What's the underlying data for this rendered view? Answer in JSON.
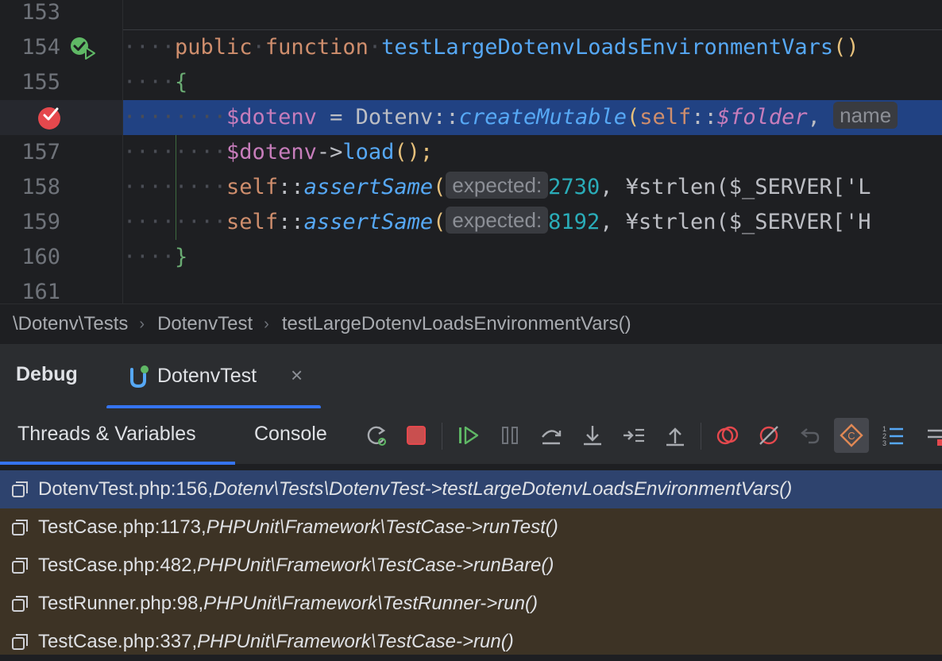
{
  "editor": {
    "line_numbers": [
      "153",
      "154",
      "155",
      "157",
      "158",
      "159",
      "160",
      "161"
    ],
    "code": {
      "l154_kw1": "public",
      "l154_kw2": "function",
      "l154_fn": "testLargeDotenvLoadsEnvironmentVars",
      "l154_paren": "()",
      "l155_brace": "{",
      "l156_var": "$dotenv",
      "l156_op": " = ",
      "l156_class": "Dotenv",
      "l156_sep": "::",
      "l156_method": "createMutable",
      "l156_open": "(",
      "l156_self": "self",
      "l156_sep2": "::",
      "l156_prop": "$folder",
      "l156_comma": ", ",
      "l156_hint": "name",
      "l157_var": "$dotenv",
      "l157_arrow": "->",
      "l157_method": "load",
      "l157_tail": "();",
      "l158_self": "self",
      "l158_sep": "::",
      "l158_method": "assertSame",
      "l158_open": "(",
      "l158_hint": "expected:",
      "l158_num": "2730",
      "l158_rest": ", ¥strlen($_SERVER['L",
      "l159_self": "self",
      "l159_sep": "::",
      "l159_method": "assertSame",
      "l159_open": "(",
      "l159_hint": "expected:",
      "l159_num": "8192",
      "l159_rest": ", ¥strlen($_SERVER['H",
      "l160_brace": "}"
    },
    "gutter_icons": [
      "run-test-passed-icon",
      "breakpoint-icon"
    ]
  },
  "breadcrumb": {
    "items": [
      "\\Dotenv\\Tests",
      "DotenvTest",
      "testLargeDotenvLoadsEnvironmentVars()"
    ],
    "separator": "›"
  },
  "debug": {
    "title": "Debug",
    "session_tab": "DotenvTest",
    "close": "×",
    "tabs": [
      "Threads & Variables",
      "Console"
    ],
    "toolbar_icons": [
      "rerun-icon",
      "stop-icon",
      "resume-icon",
      "pause-icon",
      "step-over-icon",
      "step-into-icon",
      "step-into-my-code-icon",
      "step-out-icon",
      "view-breakpoints-icon",
      "mute-breakpoints-icon",
      "reset-frame-icon",
      "evaluate-icon",
      "line-numbers-icon",
      "more-icon"
    ]
  },
  "frames": [
    {
      "location": "DotenvTest.php:156, ",
      "method": "Dotenv\\Tests\\DotenvTest->testLargeDotenvLoadsEnvironmentVars()",
      "selected": true
    },
    {
      "location": "TestCase.php:1173, ",
      "method": "PHPUnit\\Framework\\TestCase->runTest()",
      "selected": false
    },
    {
      "location": "TestCase.php:482, ",
      "method": "PHPUnit\\Framework\\TestCase->runBare()",
      "selected": false
    },
    {
      "location": "TestRunner.php:98, ",
      "method": "PHPUnit\\Framework\\TestRunner->run()",
      "selected": false
    },
    {
      "location": "TestCase.php:337, ",
      "method": "PHPUnit\\Framework\\TestCase->run()",
      "selected": false
    }
  ],
  "colors": {
    "accent": "#3574f0",
    "selected_frame": "#2e436e",
    "frames_background": "#3d3325",
    "execution_line": "#214283",
    "breakpoint": "#e5484d",
    "passed": "#5fb865"
  }
}
